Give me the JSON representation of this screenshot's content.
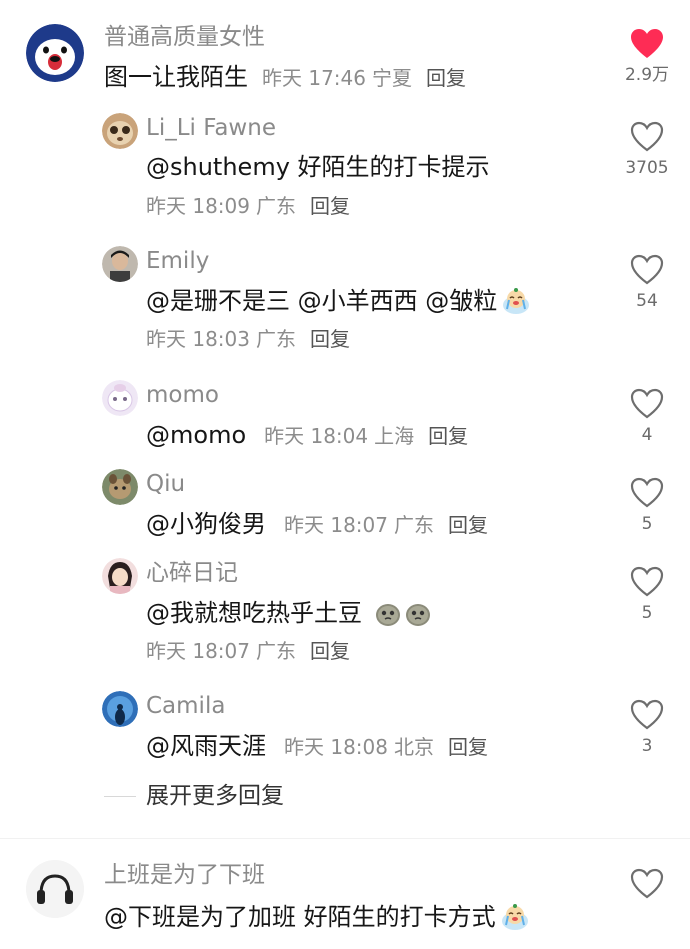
{
  "comments": [
    {
      "name": "普通高质量女性",
      "text": "图一让我陌生",
      "time": "昨天 17:46",
      "location": "宁夏",
      "reply": "回复",
      "likes": "2.9万",
      "liked": true
    },
    {
      "name": "Li_Li Fawne",
      "text": "@shuthemy  好陌生的打卡提示",
      "time": "昨天 18:09",
      "location": "广东",
      "reply": "回复",
      "likes": "3705"
    },
    {
      "name": "Emily",
      "text": "@是珊不是三  @小羊西西  @皱粒",
      "time": "昨天 18:03",
      "location": "广东",
      "reply": "回复",
      "likes": "54"
    },
    {
      "name": "momo",
      "text": "@momo",
      "time": "昨天 18:04",
      "location": "上海",
      "reply": "回复",
      "likes": "4"
    },
    {
      "name": "Qiu",
      "text": "@小狗俊男",
      "time": "昨天 18:07",
      "location": "广东",
      "reply": "回复",
      "likes": "5"
    },
    {
      "name": "心碎日记",
      "text": "@我就想吃热乎土豆",
      "time": "昨天 18:07",
      "location": "广东",
      "reply": "回复",
      "likes": "5"
    },
    {
      "name": "Camila",
      "text": "@风雨天涯",
      "time": "昨天 18:08",
      "location": "北京",
      "reply": "回复",
      "likes": "3"
    },
    {
      "name": "上班是为了下班",
      "text": "@下班是为了加班  好陌生的打卡方式",
      "likes": ""
    }
  ],
  "expand_replies": "展开更多回复",
  "colors": {
    "liked_heart": "#fe2c55",
    "name_gray": "#8a8a8a",
    "meta_gray": "#8c8c8c"
  }
}
